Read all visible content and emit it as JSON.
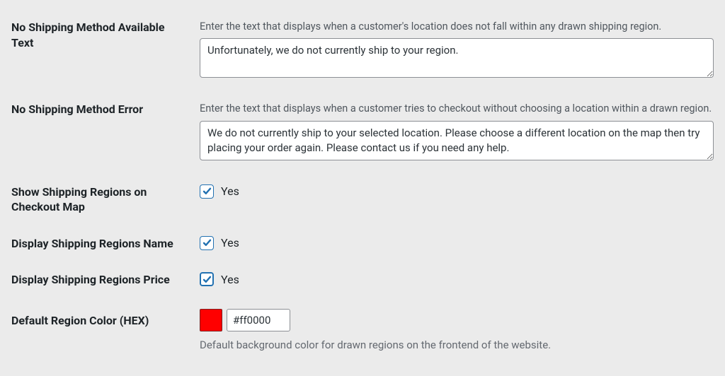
{
  "no_shipping_text": {
    "label": "No Shipping Method Available Text",
    "help": "Enter the text that displays when a customer's location does not fall within any drawn shipping region.",
    "value": "Unfortunately, we do not currently ship to your region."
  },
  "no_shipping_error": {
    "label": "No Shipping Method Error",
    "help": "Enter the text that displays when a customer tries to checkout without choosing a location within a drawn region.",
    "value": "We do not currently ship to your selected location. Please choose a different location on the map then try placing your order again. Please contact us if you need any help."
  },
  "show_regions_map": {
    "label": "Show Shipping Regions on Checkout Map",
    "option": "Yes",
    "checked": true
  },
  "display_region_name": {
    "label": "Display Shipping Regions Name",
    "option": "Yes",
    "checked": true
  },
  "display_region_price": {
    "label": "Display Shipping Regions Price",
    "option": "Yes",
    "checked": true
  },
  "default_color": {
    "label": "Default Region Color (HEX)",
    "value": "#ff0000",
    "swatch": "#ff0000",
    "help": "Default background color for drawn regions on the frontend of the website."
  }
}
